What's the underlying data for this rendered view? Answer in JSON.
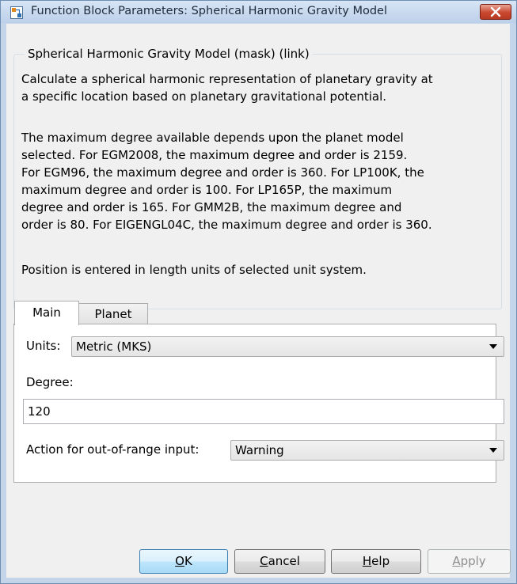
{
  "window": {
    "title": "Function Block Parameters: Spherical Harmonic Gravity Model"
  },
  "group": {
    "legend": "Spherical Harmonic Gravity Model (mask) (link)",
    "description": [
      "Calculate a spherical harmonic representation of planetary gravity at",
      "a specific location based on planetary gravitational potential.",
      "The maximum degree available depends upon the planet model",
      "selected.  For EGM2008, the maximum degree and order is 2159.",
      "For EGM96, the maximum degree and order is 360.  For LP100K, the",
      "maximum degree and order is 100.  For LP165P, the maximum",
      "degree and order is 165.  For GMM2B, the maximum degree and",
      "order is 80.  For EIGENGL04C, the maximum degree and order is 360.",
      "Position is entered in length units of selected unit system."
    ]
  },
  "tabs": [
    {
      "label": "Main"
    },
    {
      "label": "Planet"
    }
  ],
  "main": {
    "units_label": "Units:",
    "units_value": "Metric (MKS)",
    "degree_label": "Degree:",
    "degree_value": "120",
    "action_label": "Action for out-of-range input:",
    "action_value": "Warning"
  },
  "buttons": {
    "ok": {
      "first": "O",
      "rest": "K"
    },
    "cancel": {
      "first": "C",
      "rest": "ancel"
    },
    "help": {
      "first": "H",
      "rest": "elp"
    },
    "apply": {
      "first": "A",
      "rest": "pply"
    }
  },
  "colors": {
    "titlebar": "#c4d5ea",
    "close_button": "#c9472f",
    "ok_button": "#bee6fd"
  }
}
